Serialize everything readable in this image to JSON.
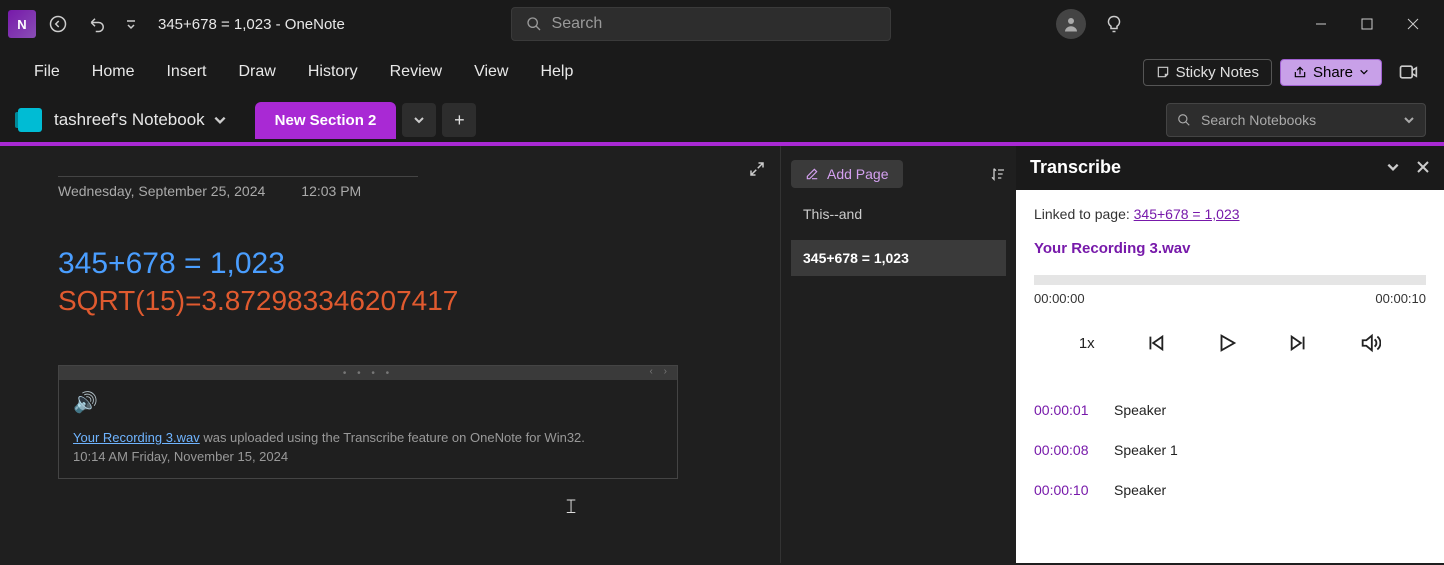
{
  "titlebar": {
    "doc_title": "345+678 = 1,023  -  OneNote",
    "search_placeholder": "Search"
  },
  "menubar": {
    "items": [
      "File",
      "Home",
      "Insert",
      "Draw",
      "History",
      "Review",
      "View",
      "Help"
    ],
    "sticky": "Sticky Notes",
    "share": "Share"
  },
  "notebook": {
    "name": "tashreef's Notebook",
    "section_tab": "New Section 2",
    "search_placeholder": "Search Notebooks"
  },
  "note": {
    "date": "Wednesday, September 25, 2024",
    "time": "12:03 PM",
    "line1": "345+678 = 1,023",
    "line2": "SQRT(15)=3.872983346207417",
    "recording_link": "Your Recording 3.wav",
    "recording_text": " was uploaded using the Transcribe feature on OneNote for Win32.",
    "recording_time": "10:14 AM Friday, November 15, 2024"
  },
  "pages": {
    "add_label": "Add Page",
    "items": [
      "This--and",
      "345+678 = 1,023"
    ]
  },
  "transcribe": {
    "title": "Transcribe",
    "linked_prefix": "Linked to page: ",
    "linked_page": "345+678 = 1,023",
    "recording_name": "Your Recording 3.wav",
    "t_start": "00:00:00",
    "t_end": "00:00:10",
    "speed": "1x",
    "rows": [
      {
        "ts": "00:00:01",
        "sp": "Speaker"
      },
      {
        "ts": "00:00:08",
        "sp": "Speaker 1"
      },
      {
        "ts": "00:00:10",
        "sp": "Speaker"
      }
    ]
  },
  "colors": {
    "accent": "#a929d4",
    "link": "#7719aa"
  }
}
